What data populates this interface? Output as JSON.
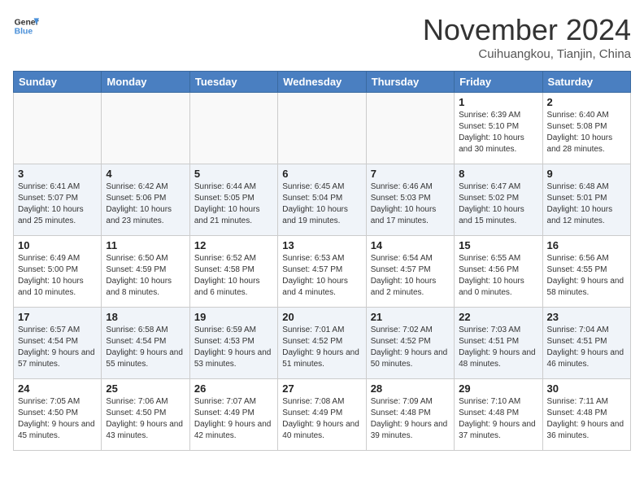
{
  "header": {
    "logo_line1": "General",
    "logo_line2": "Blue",
    "month": "November 2024",
    "location": "Cuihuangkou, Tianjin, China"
  },
  "weekdays": [
    "Sunday",
    "Monday",
    "Tuesday",
    "Wednesday",
    "Thursday",
    "Friday",
    "Saturday"
  ],
  "weeks": [
    [
      {
        "day": "",
        "info": ""
      },
      {
        "day": "",
        "info": ""
      },
      {
        "day": "",
        "info": ""
      },
      {
        "day": "",
        "info": ""
      },
      {
        "day": "",
        "info": ""
      },
      {
        "day": "1",
        "info": "Sunrise: 6:39 AM\nSunset: 5:10 PM\nDaylight: 10 hours and 30 minutes."
      },
      {
        "day": "2",
        "info": "Sunrise: 6:40 AM\nSunset: 5:08 PM\nDaylight: 10 hours and 28 minutes."
      }
    ],
    [
      {
        "day": "3",
        "info": "Sunrise: 6:41 AM\nSunset: 5:07 PM\nDaylight: 10 hours and 25 minutes."
      },
      {
        "day": "4",
        "info": "Sunrise: 6:42 AM\nSunset: 5:06 PM\nDaylight: 10 hours and 23 minutes."
      },
      {
        "day": "5",
        "info": "Sunrise: 6:44 AM\nSunset: 5:05 PM\nDaylight: 10 hours and 21 minutes."
      },
      {
        "day": "6",
        "info": "Sunrise: 6:45 AM\nSunset: 5:04 PM\nDaylight: 10 hours and 19 minutes."
      },
      {
        "day": "7",
        "info": "Sunrise: 6:46 AM\nSunset: 5:03 PM\nDaylight: 10 hours and 17 minutes."
      },
      {
        "day": "8",
        "info": "Sunrise: 6:47 AM\nSunset: 5:02 PM\nDaylight: 10 hours and 15 minutes."
      },
      {
        "day": "9",
        "info": "Sunrise: 6:48 AM\nSunset: 5:01 PM\nDaylight: 10 hours and 12 minutes."
      }
    ],
    [
      {
        "day": "10",
        "info": "Sunrise: 6:49 AM\nSunset: 5:00 PM\nDaylight: 10 hours and 10 minutes."
      },
      {
        "day": "11",
        "info": "Sunrise: 6:50 AM\nSunset: 4:59 PM\nDaylight: 10 hours and 8 minutes."
      },
      {
        "day": "12",
        "info": "Sunrise: 6:52 AM\nSunset: 4:58 PM\nDaylight: 10 hours and 6 minutes."
      },
      {
        "day": "13",
        "info": "Sunrise: 6:53 AM\nSunset: 4:57 PM\nDaylight: 10 hours and 4 minutes."
      },
      {
        "day": "14",
        "info": "Sunrise: 6:54 AM\nSunset: 4:57 PM\nDaylight: 10 hours and 2 minutes."
      },
      {
        "day": "15",
        "info": "Sunrise: 6:55 AM\nSunset: 4:56 PM\nDaylight: 10 hours and 0 minutes."
      },
      {
        "day": "16",
        "info": "Sunrise: 6:56 AM\nSunset: 4:55 PM\nDaylight: 9 hours and 58 minutes."
      }
    ],
    [
      {
        "day": "17",
        "info": "Sunrise: 6:57 AM\nSunset: 4:54 PM\nDaylight: 9 hours and 57 minutes."
      },
      {
        "day": "18",
        "info": "Sunrise: 6:58 AM\nSunset: 4:54 PM\nDaylight: 9 hours and 55 minutes."
      },
      {
        "day": "19",
        "info": "Sunrise: 6:59 AM\nSunset: 4:53 PM\nDaylight: 9 hours and 53 minutes."
      },
      {
        "day": "20",
        "info": "Sunrise: 7:01 AM\nSunset: 4:52 PM\nDaylight: 9 hours and 51 minutes."
      },
      {
        "day": "21",
        "info": "Sunrise: 7:02 AM\nSunset: 4:52 PM\nDaylight: 9 hours and 50 minutes."
      },
      {
        "day": "22",
        "info": "Sunrise: 7:03 AM\nSunset: 4:51 PM\nDaylight: 9 hours and 48 minutes."
      },
      {
        "day": "23",
        "info": "Sunrise: 7:04 AM\nSunset: 4:51 PM\nDaylight: 9 hours and 46 minutes."
      }
    ],
    [
      {
        "day": "24",
        "info": "Sunrise: 7:05 AM\nSunset: 4:50 PM\nDaylight: 9 hours and 45 minutes."
      },
      {
        "day": "25",
        "info": "Sunrise: 7:06 AM\nSunset: 4:50 PM\nDaylight: 9 hours and 43 minutes."
      },
      {
        "day": "26",
        "info": "Sunrise: 7:07 AM\nSunset: 4:49 PM\nDaylight: 9 hours and 42 minutes."
      },
      {
        "day": "27",
        "info": "Sunrise: 7:08 AM\nSunset: 4:49 PM\nDaylight: 9 hours and 40 minutes."
      },
      {
        "day": "28",
        "info": "Sunrise: 7:09 AM\nSunset: 4:48 PM\nDaylight: 9 hours and 39 minutes."
      },
      {
        "day": "29",
        "info": "Sunrise: 7:10 AM\nSunset: 4:48 PM\nDaylight: 9 hours and 37 minutes."
      },
      {
        "day": "30",
        "info": "Sunrise: 7:11 AM\nSunset: 4:48 PM\nDaylight: 9 hours and 36 minutes."
      }
    ]
  ]
}
